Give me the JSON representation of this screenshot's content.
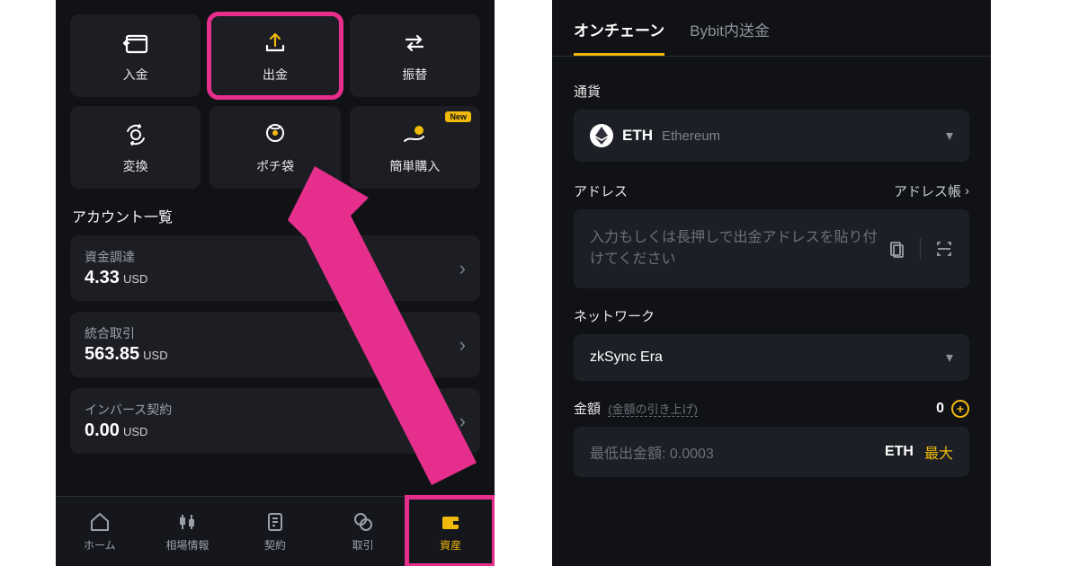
{
  "left": {
    "actions": {
      "deposit": "入金",
      "withdraw": "出金",
      "transfer": "振替",
      "convert": "変換",
      "pochibukuro": "ポチ袋",
      "easybuy": "簡単購入",
      "new_badge": "New"
    },
    "section_title": "アカウント一覧",
    "accounts": [
      {
        "name": "資金調達",
        "value": "4.33",
        "unit": "USD"
      },
      {
        "name": "統合取引",
        "value": "563.85",
        "unit": "USD"
      },
      {
        "name": "インバース契約",
        "value": "0.00",
        "unit": "USD"
      }
    ],
    "nav": {
      "home": "ホーム",
      "markets": "相場情報",
      "contracts": "契約",
      "trade": "取引",
      "assets": "資産"
    }
  },
  "right": {
    "tabs": {
      "onchain": "オンチェーン",
      "internal": "Bybit内送金"
    },
    "currency_label": "通貨",
    "currency_symbol": "ETH",
    "currency_name": "Ethereum",
    "address_label": "アドレス",
    "address_book": "アドレス帳",
    "address_placeholder": "入力もしくは長押しで出金アドレスを貼り付けてください",
    "network_label": "ネットワーク",
    "network_value": "zkSync Era",
    "amount_label": "金額",
    "amount_sub": "(金額の引き上げ)",
    "amount_value": "0",
    "amount_placeholder": "最低出金額: 0.0003",
    "amount_coin": "ETH",
    "amount_max": "最大"
  }
}
